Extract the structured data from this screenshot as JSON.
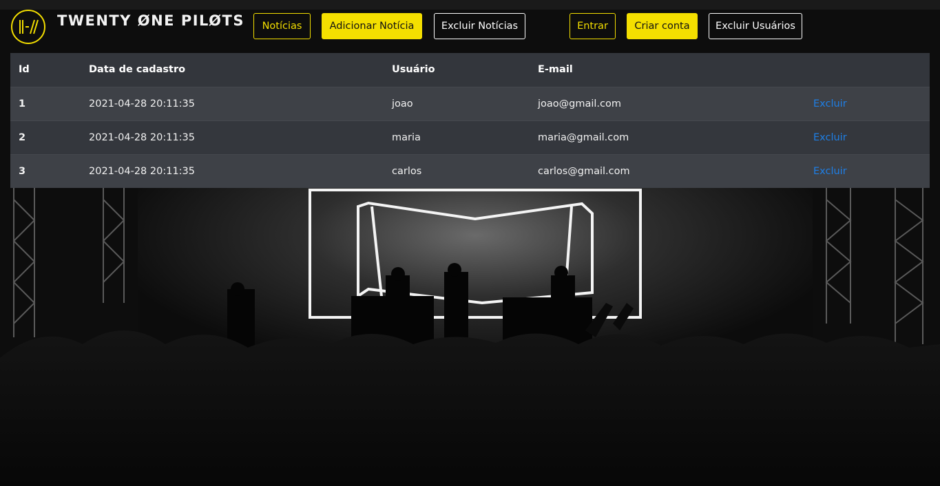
{
  "header": {
    "brand": "TWENTY ØNE PILØTS",
    "logo_icon": "twenty-one-pilots-logo-icon",
    "accent_color": "#f4df00",
    "nav": {
      "noticias": "Notícias",
      "adicionar_noticia": "Adicionar Notícia",
      "excluir_noticias": "Excluir Notícias",
      "entrar": "Entrar",
      "criar_conta": "Criar conta",
      "excluir_usuarios": "Excluir Usuários"
    }
  },
  "users_table": {
    "headers": {
      "id": "Id",
      "data": "Data de cadastro",
      "usuario": "Usuário",
      "email": "E-mail"
    },
    "rows": [
      {
        "id": "1",
        "data": "2021-04-28 20:11:35",
        "usuario": "joao",
        "email": "joao@gmail.com",
        "action": "Excluir"
      },
      {
        "id": "2",
        "data": "2021-04-28 20:11:35",
        "usuario": "maria",
        "email": "maria@gmail.com",
        "action": "Excluir"
      },
      {
        "id": "3",
        "data": "2021-04-28 20:11:35",
        "usuario": "carlos",
        "email": "carlos@gmail.com",
        "action": "Excluir"
      }
    ],
    "link_color": "#1e7fe6"
  }
}
